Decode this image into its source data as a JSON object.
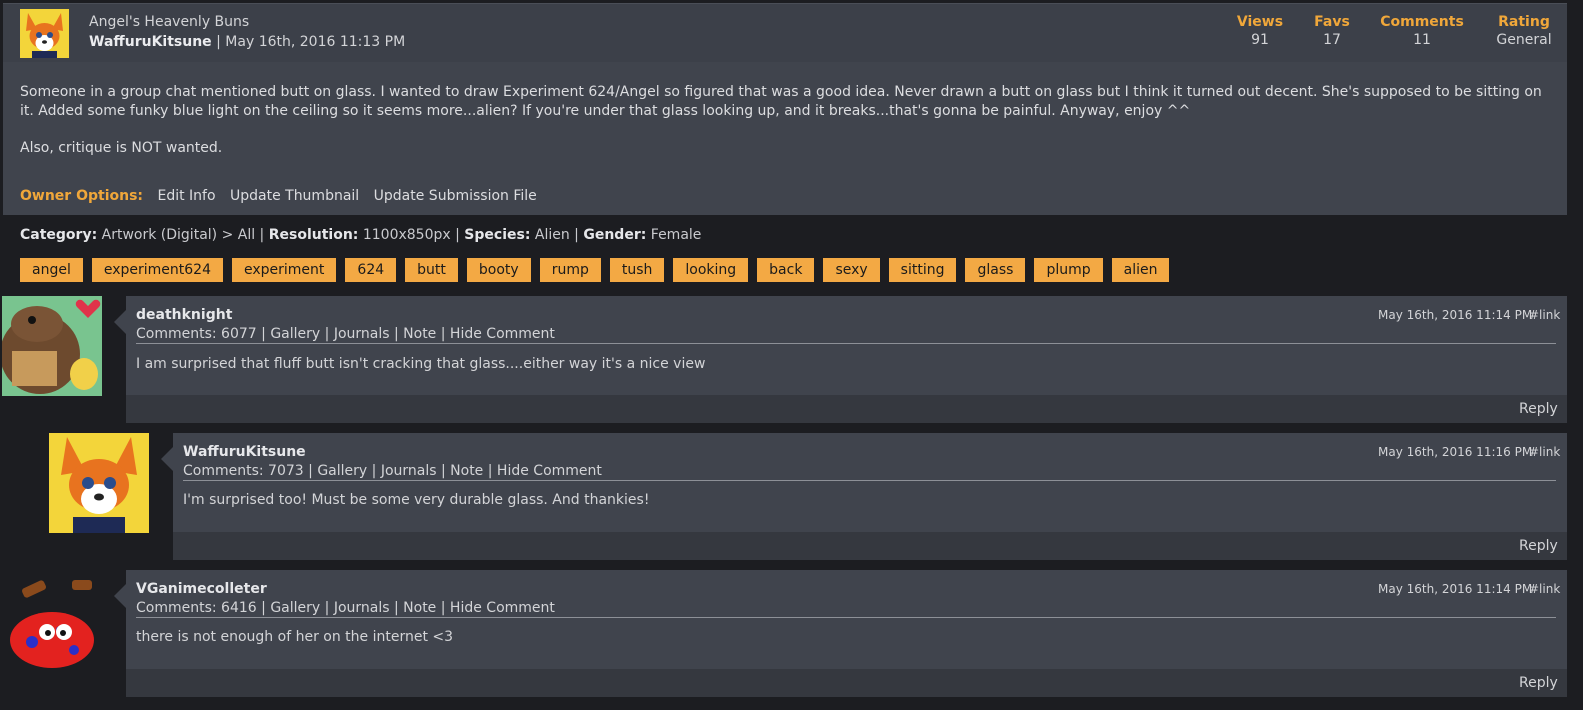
{
  "submission": {
    "title": "Angel's Heavenly Buns",
    "author": "WaffuruKitsune",
    "date": "May 16th, 2016 11:13 PM"
  },
  "stats": [
    {
      "label": "Views",
      "value": "91"
    },
    {
      "label": "Favs",
      "value": "17"
    },
    {
      "label": "Comments",
      "value": "11"
    },
    {
      "label": "Rating",
      "value": "General"
    }
  ],
  "description": {
    "para1": "Someone in a group chat mentioned butt on glass. I wanted to draw Experiment 624/Angel so figured that was a good idea. Never drawn a butt on glass but I think it turned out decent. She's supposed to be sitting on it. Added some funky blue light on the ceiling so it seems more...alien? If you're under that glass looking up, and it breaks...that's gonna be painful. Anyway, enjoy ^^",
    "para2": "Also, critique is NOT wanted."
  },
  "owner_options": {
    "label": "Owner Options:",
    "links": [
      "Edit Info",
      "Update Thumbnail",
      "Update Submission File"
    ]
  },
  "meta": {
    "category_label": "Category:",
    "category": "Artwork (Digital) > All",
    "resolution_label": "Resolution:",
    "resolution": "1100x850px",
    "species_label": "Species:",
    "species": "Alien",
    "gender_label": "Gender:",
    "gender": "Female"
  },
  "tags": [
    "angel",
    "experiment624",
    "experiment",
    "624",
    "butt",
    "booty",
    "rump",
    "tush",
    "looking",
    "back",
    "sexy",
    "sitting",
    "glass",
    "plump",
    "alien"
  ],
  "comments": [
    {
      "user": "deathknight",
      "count": "Comments: 6077",
      "date": "May 16th, 2016 11:14 PM",
      "link": "#link",
      "body": "I am surprised that fluff butt isn't cracking that glass....either way it's a nice view",
      "reply": "Reply"
    },
    {
      "user": "WaffuruKitsune",
      "count": "Comments: 7073",
      "date": "May 16th, 2016 11:16 PM",
      "link": "#link",
      "body": "I'm surprised too! Must be some very durable glass. And thankies!",
      "reply": "Reply"
    },
    {
      "user": "VGanimecolleter",
      "count": "Comments: 6416",
      "date": "May 16th, 2016 11:14 PM",
      "link": "#link",
      "body": "there is not enough of her on the internet <3",
      "reply": "Reply"
    }
  ],
  "comment_links": [
    "Gallery",
    "Journals",
    "Note",
    "Hide Comment"
  ],
  "colors": {
    "accent": "#f0a73a",
    "tag_bg": "#f3a944",
    "panel": "#40444d",
    "page_bg": "#1c1d21"
  }
}
